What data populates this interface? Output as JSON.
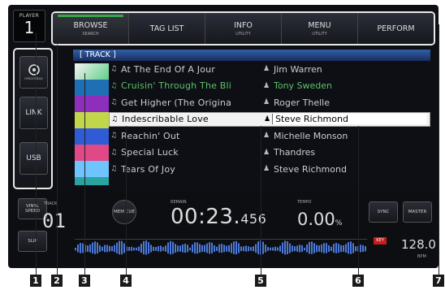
{
  "player": {
    "label": "PLAYER",
    "number": "1"
  },
  "tabs": [
    {
      "label": "BROWSE",
      "sub": "SEARCH"
    },
    {
      "label": "TAG LIST",
      "sub": ""
    },
    {
      "label": "INFO",
      "sub": "UTILITY"
    },
    {
      "label": "MENU",
      "sub": "UTILITY"
    },
    {
      "label": "PERFORM",
      "sub": ""
    }
  ],
  "sidebar": {
    "source_label": "rekordbox",
    "link_label": "LINK",
    "usb_label": "USB"
  },
  "breadcrumb": "[ TRACK ]",
  "tracks": [
    {
      "title": "At The End Of A Jour",
      "artist": "Jim Warren",
      "state": "normal"
    },
    {
      "title": "Cruisin' Through The Bli",
      "artist": "Tony Sweden",
      "state": "played"
    },
    {
      "title": "Get Higher (The Origina",
      "artist": "Roger Thelle",
      "state": "normal"
    },
    {
      "title": "Indescribable Love",
      "artist": "Steve Richmond",
      "state": "selected"
    },
    {
      "title": "Reachin' Out",
      "artist": "Michelle Monson",
      "state": "normal"
    },
    {
      "title": "Special Luck",
      "artist": "Thandres",
      "state": "normal"
    },
    {
      "title": "Tears Of Joy",
      "artist": "Steve Richmond",
      "state": "normal"
    }
  ],
  "deck": {
    "vinyl_speed_label": "VINYL SPEED",
    "slip_label": "SLIP",
    "track_label": "TRACK",
    "track_number": "01",
    "cue_label": "MEM CUE",
    "remain_label": "REMAIN",
    "time_main": "00:23.",
    "time_frac": "456",
    "tempo_label": "TEMPO",
    "tempo_value": "0.00",
    "tempo_unit": "%",
    "sync_label": "SYNC",
    "master_label": "MASTER",
    "bpm_value": "128.0",
    "bpm_unit": "BPM",
    "indicator_label": "KEY"
  },
  "callouts": [
    "1",
    "2",
    "3",
    "4",
    "5",
    "6",
    "7"
  ],
  "colors": {
    "played": "#5fc06a",
    "header_blue": "#3060a8",
    "active_tab": "#3aa84a"
  }
}
